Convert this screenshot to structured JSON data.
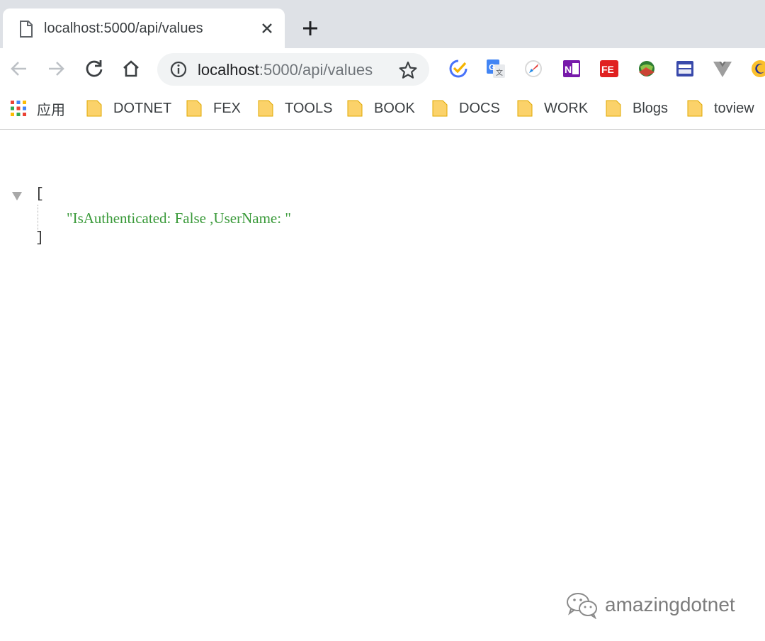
{
  "tab": {
    "title": "localhost:5000/api/values",
    "favicon": "document-icon",
    "close_icon": "close-icon",
    "new_tab_icon": "plus-icon"
  },
  "toolbar": {
    "icons": [
      "back-icon",
      "forward-icon",
      "reload-icon",
      "home-icon"
    ],
    "url": {
      "host": "localhost",
      "rest": ":5000/api/values"
    },
    "info_icon": "info-icon",
    "bookmark_star_icon": "star-icon",
    "extensions": [
      "tick-tick-icon",
      "google-translate-icon",
      "rocket-icon",
      "onenote-icon",
      "fe-icon",
      "globe-icon",
      "window-icon",
      "vue-devtools-icon",
      "moon-icon"
    ]
  },
  "bookmarks": {
    "apps_label": "应用",
    "items": [
      {
        "label": "DOTNET"
      },
      {
        "label": "FEX"
      },
      {
        "label": "TOOLS"
      },
      {
        "label": "BOOK"
      },
      {
        "label": "DOCS"
      },
      {
        "label": "WORK"
      },
      {
        "label": "Blogs"
      },
      {
        "label": "toview"
      }
    ]
  },
  "json_view": {
    "open_bracket": "[",
    "value": "\"IsAuthenticated: False ,UserName: \"",
    "close_bracket": "]"
  },
  "watermark": {
    "text": "amazingdotnet"
  },
  "colors": {
    "tabstrip": "#dee1e6",
    "omnibox": "#f1f3f4",
    "folder": "#fbd26a",
    "json_string": "#3a9a3a"
  }
}
